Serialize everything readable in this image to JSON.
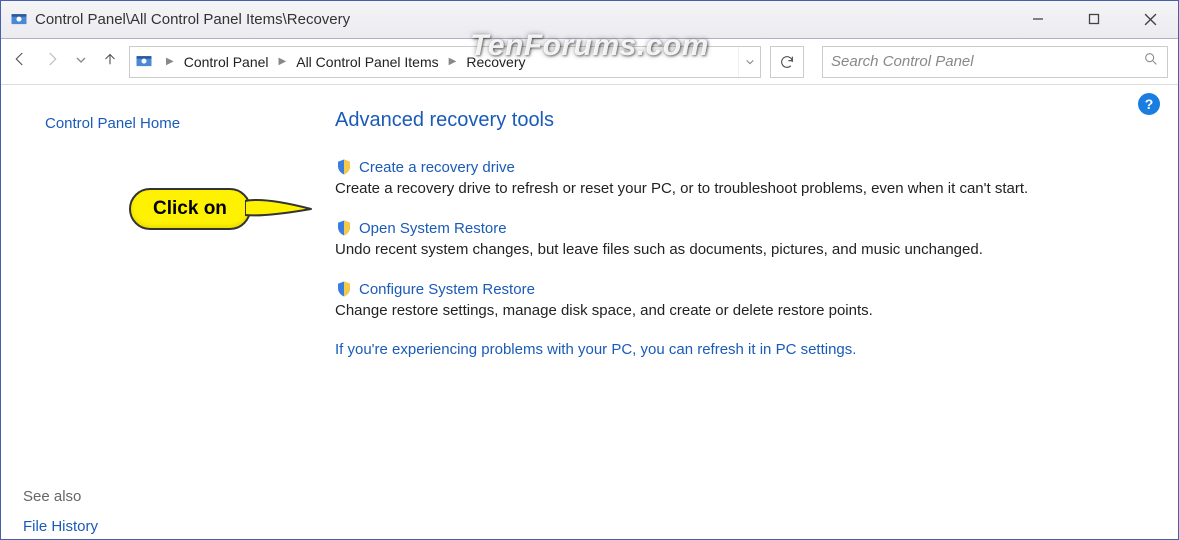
{
  "titlebar": {
    "path": "Control Panel\\All Control Panel Items\\Recovery"
  },
  "watermark": "TenForums.com",
  "breadcrumb": {
    "items": [
      "Control Panel",
      "All Control Panel Items",
      "Recovery"
    ]
  },
  "search": {
    "placeholder": "Search Control Panel"
  },
  "sidebar": {
    "home": "Control Panel Home",
    "see_also": "See also",
    "file_history": "File History"
  },
  "main": {
    "heading": "Advanced recovery tools",
    "tools": [
      {
        "link": "Create a recovery drive",
        "desc": "Create a recovery drive to refresh or reset your PC, or to troubleshoot problems, even when it can't start."
      },
      {
        "link": "Open System Restore",
        "desc": "Undo recent system changes, but leave files such as documents, pictures, and music unchanged."
      },
      {
        "link": "Configure System Restore",
        "desc": "Change restore settings, manage disk space, and create or delete restore points."
      }
    ],
    "footer_link": "If you're experiencing problems with your PC, you can refresh it in PC settings."
  },
  "callout": {
    "text": "Click on"
  }
}
